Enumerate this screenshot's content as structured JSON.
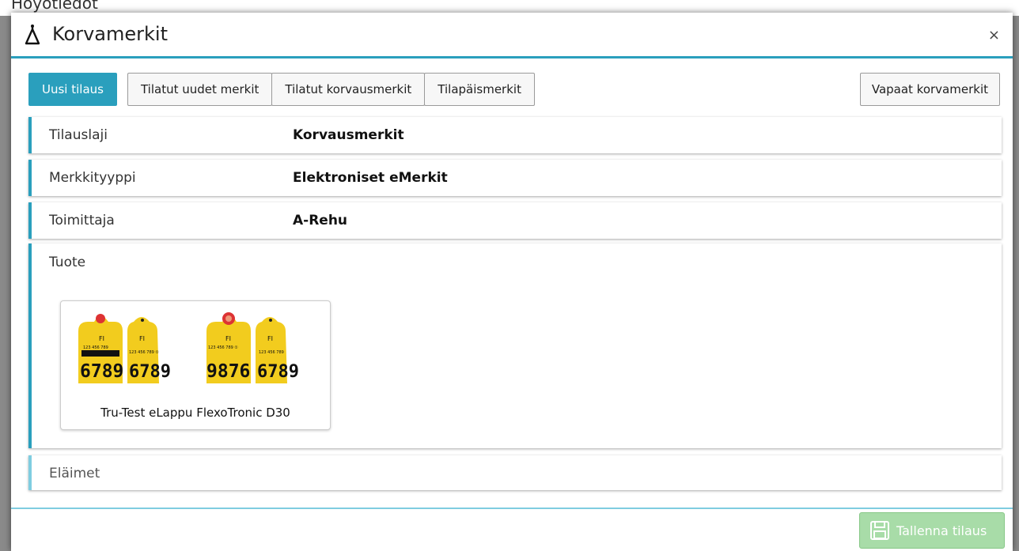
{
  "background": {
    "text": "Hoyotiedot"
  },
  "modal": {
    "title": "Korvamerkit",
    "close_label": "×"
  },
  "tabs": [
    {
      "label": "Uusi tilaus",
      "active": true
    },
    {
      "label": "Tilatut uudet merkit",
      "active": false
    },
    {
      "label": "Tilatut korvausmerkit",
      "active": false
    },
    {
      "label": "Tilapäismerkit",
      "active": false
    }
  ],
  "free_button": {
    "label": "Vapaat korvamerkit"
  },
  "fields": {
    "order_type": {
      "label": "Tilauslaji",
      "value": "Korvausmerkit"
    },
    "tag_type": {
      "label": "Merkkityyppi",
      "value": "Elektroniset eMerkit"
    },
    "supplier": {
      "label": "Toimittaja",
      "value": "A-Rehu"
    },
    "product": {
      "label": "Tuote"
    },
    "animals": {
      "label": "Eläimet"
    }
  },
  "product_card": {
    "name": "Tru-Test eLappu FlexoTronic D30",
    "tags": [
      {
        "country": "FI",
        "small": "123 456 789",
        "big": "6789"
      },
      {
        "country": "FI",
        "small": "123 456 789 ①",
        "big": "6789"
      },
      {
        "country": "FI",
        "small": "123 456 789 ①",
        "big": "9876"
      },
      {
        "country": "FI",
        "small": "123 456 789",
        "big": "6789"
      }
    ]
  },
  "save_button": {
    "label": "Tallenna tilaus",
    "enabled": false
  },
  "colors": {
    "accent": "#2a9fbd",
    "save_disabled": "#a8dca8",
    "tag_yellow": "#f2cc1e"
  },
  "icons": {
    "title": "bag-icon",
    "close": "close-icon",
    "save": "floppy-disk-icon"
  }
}
